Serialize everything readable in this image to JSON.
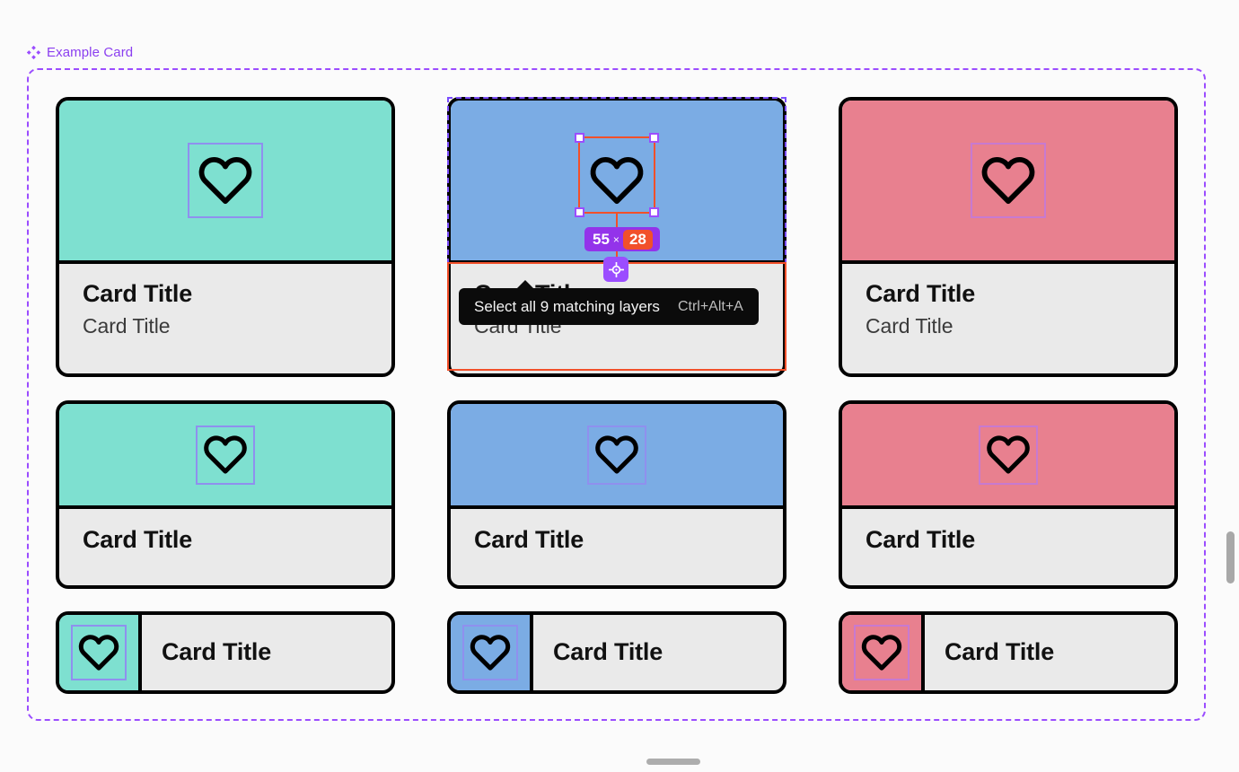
{
  "frame": {
    "label": "Example Card",
    "icon": "component-diamond-icon",
    "border_color": "#9b4dff"
  },
  "colors": {
    "teal": "#7ee0d0",
    "blue": "#7bace4",
    "pink": "#e8808f",
    "body_gray": "#eaeaea",
    "outline_black": "#000000",
    "icon_box_purple": "#8f90ee",
    "icon_box_orchid": "#c77ad0",
    "selection_orange": "#f2502a",
    "selection_purple": "#9b4dff",
    "badge_purple": "#9333ea",
    "canvas": "#fbfbfb"
  },
  "cards": {
    "row1": [
      {
        "name": "card-teal-tall",
        "media_color": "#7ee0d0",
        "icon": "heart-icon",
        "icon_box": "#8f90ee",
        "title": "Card Title",
        "subtitle": "Card Title"
      },
      {
        "name": "card-blue-tall",
        "media_color": "#7bace4",
        "icon": "heart-icon",
        "icon_box": "#8f90ee",
        "title": "Card Title",
        "subtitle": "Card Title"
      },
      {
        "name": "card-pink-tall",
        "media_color": "#e8808f",
        "icon": "heart-icon",
        "icon_box": "#c77ad0",
        "title": "Card Title",
        "subtitle": "Card Title"
      }
    ],
    "row2": [
      {
        "name": "card-teal-short",
        "media_color": "#7ee0d0",
        "icon": "heart-icon",
        "icon_box": "#8f90ee",
        "title": "Card Title"
      },
      {
        "name": "card-blue-short",
        "media_color": "#7bace4",
        "icon": "heart-icon",
        "icon_box": "#8f90ee",
        "title": "Card Title"
      },
      {
        "name": "card-pink-short",
        "media_color": "#e8808f",
        "icon": "heart-icon",
        "icon_box": "#c77ad0",
        "title": "Card Title"
      }
    ],
    "row3": [
      {
        "name": "card-teal-horizontal",
        "media_color": "#7ee0d0",
        "icon": "heart-icon",
        "icon_box": "#8f90ee",
        "title": "Card Title"
      },
      {
        "name": "card-blue-horizontal",
        "media_color": "#7bace4",
        "icon": "heart-icon",
        "icon_box": "#8f90ee",
        "title": "Card Title"
      },
      {
        "name": "card-pink-horizontal",
        "media_color": "#e8808f",
        "icon": "heart-icon",
        "icon_box": "#c77ad0",
        "title": "Card Title"
      }
    ]
  },
  "selection": {
    "size_badge": {
      "width": "55",
      "separator": "×",
      "height": "28"
    },
    "crosshair_icon": "target-crosshair-icon",
    "tooltip": {
      "text": "Select all 9 matching layers",
      "shortcut": "Ctrl+Alt+A"
    }
  },
  "chrome": {
    "vertical_scrollbar": "scrollbar-thumb",
    "bottom_handle": "window-resize-handle"
  }
}
